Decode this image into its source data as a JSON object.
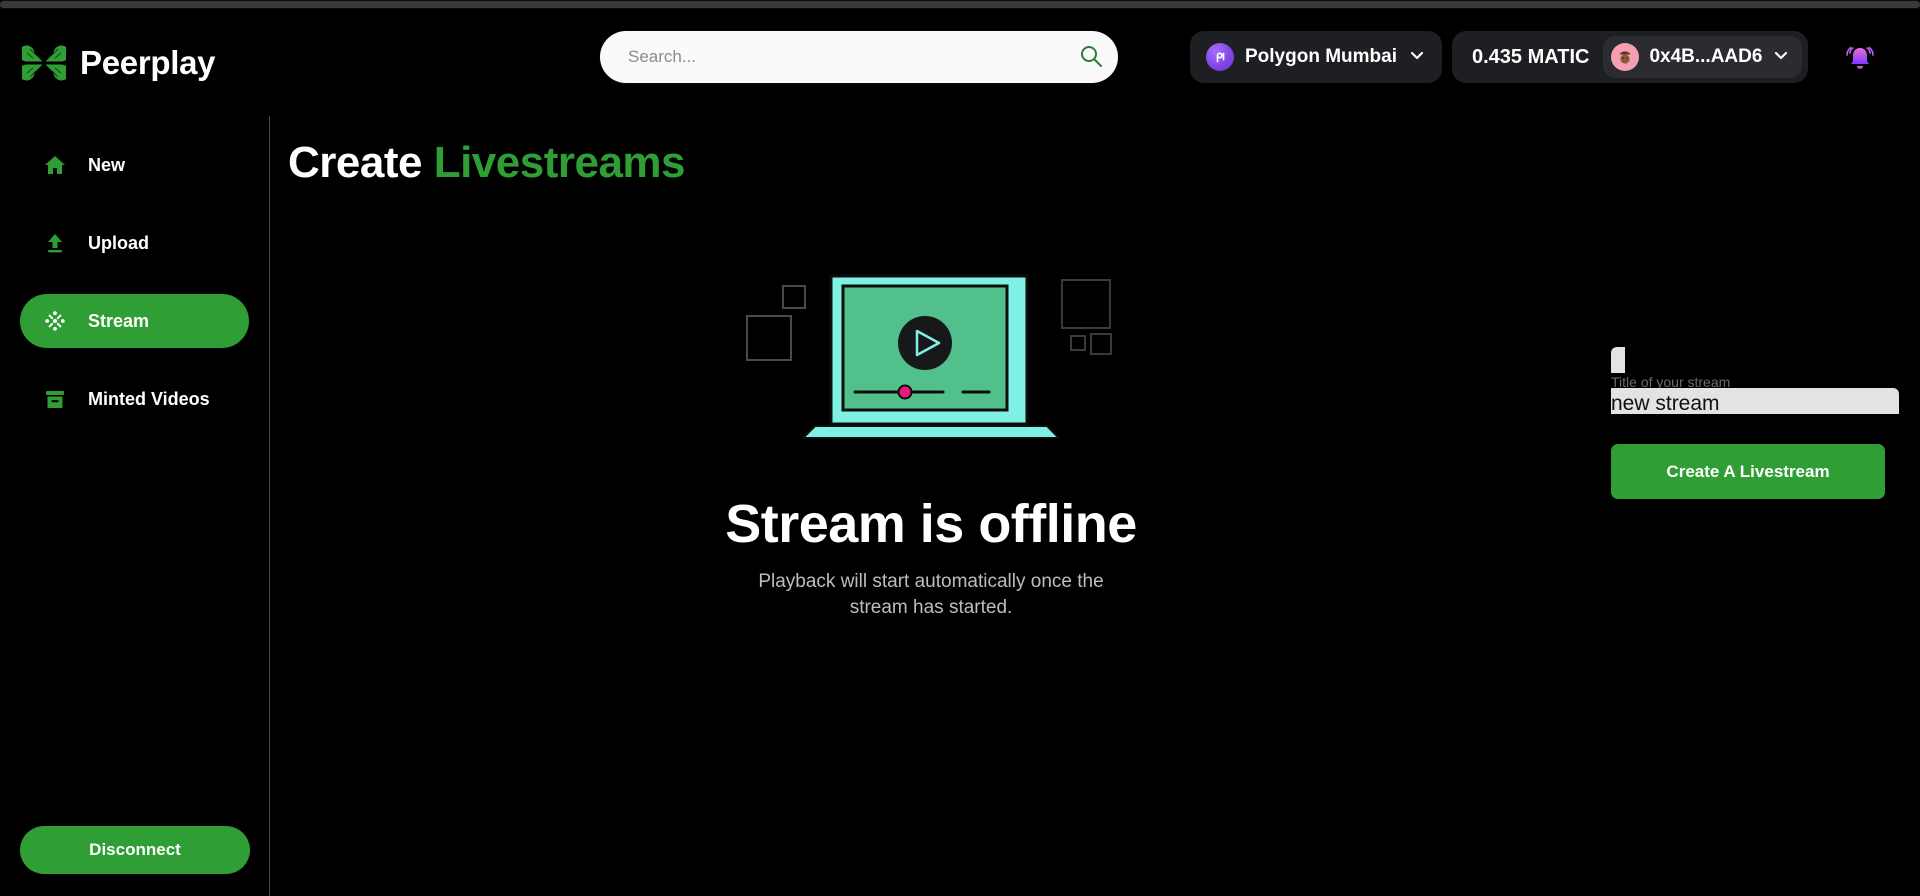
{
  "brand": {
    "name": "Peerplay",
    "logo_icon": "peerplay-cross-logo",
    "color": "#2e9e35"
  },
  "search": {
    "placeholder": "Search...",
    "value": "",
    "icon": "search-icon"
  },
  "header": {
    "network": {
      "label": "Polygon Mumbai",
      "icon": "polygon-icon",
      "chevron": "chevron-down-icon",
      "color": "#8247e5"
    },
    "balance": "0.435 MATIC",
    "address": "0x4B...AAD6",
    "avatar_icon": "user-avatar-icon",
    "address_chevron": "chevron-down-icon",
    "notifications_icon": "bell-icon"
  },
  "sidebar": {
    "items": [
      {
        "label": "New",
        "icon": "home-icon",
        "active": false
      },
      {
        "label": "Upload",
        "icon": "upload-icon",
        "active": false
      },
      {
        "label": "Stream",
        "icon": "stream-burst-icon",
        "active": true
      },
      {
        "label": "Minted Videos",
        "icon": "archive-box-icon",
        "active": false
      }
    ],
    "disconnect_label": "Disconnect"
  },
  "main": {
    "title_primary": "Create",
    "title_accent": "Livestreams",
    "player": {
      "illustration_icon": "laptop-video-player-illustration",
      "offline_title": "Stream is offline",
      "offline_subtitle": "Playback will start automatically once the stream has started."
    },
    "form": {
      "title_field_label": "Title of your stream",
      "title_field_value": "new stream",
      "title_field_placeholder": "Title of your stream",
      "create_button_label": "Create A Livestream"
    }
  }
}
